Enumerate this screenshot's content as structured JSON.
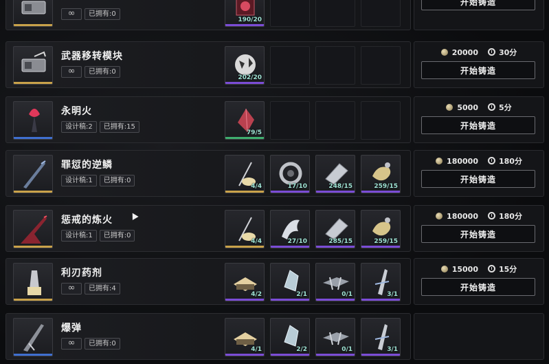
{
  "colors": {
    "gold": "#c9a24a",
    "purple": "#7b4cd6",
    "blue": "#3f6fd0",
    "green": "#3fae6e"
  },
  "rows": [
    {
      "name": "",
      "tags": [
        "∞",
        "已拥有:0"
      ],
      "rarity": "gold",
      "icon": "weapon-module-icon",
      "mats": [
        {
          "cnt": "190/20",
          "rarity": "purple",
          "icon": "crimson-core-icon"
        },
        null,
        null,
        null
      ],
      "cost": null,
      "button": "开始铸造"
    },
    {
      "name": "武器移转模块",
      "tags": [
        "∞",
        "已拥有:0"
      ],
      "rarity": "gold",
      "icon": "weapon-module-icon",
      "mats": [
        {
          "cnt": "202/20",
          "rarity": "purple",
          "icon": "orb-icon"
        },
        null,
        null,
        null
      ],
      "cost": {
        "coin": "20000",
        "time": "30分"
      },
      "button": "开始铸造"
    },
    {
      "name": "永明火",
      "tags": [
        "设计稿:2",
        "已拥有:15"
      ],
      "rarity": "blue",
      "icon": "torch-icon",
      "mats": [
        {
          "cnt": "79/5",
          "rarity": "green",
          "icon": "red-crystal-icon"
        },
        null,
        null,
        null
      ],
      "cost": {
        "coin": "5000",
        "time": "5分"
      },
      "button": "开始铸造"
    },
    {
      "name": "罪愆的逆鳞",
      "tags": [
        "设计稿:1",
        "已拥有:0"
      ],
      "rarity": "gold",
      "icon": "dark-blade-icon",
      "mats": [
        {
          "cnt": "4/4",
          "rarity": "gold",
          "icon": "staff-icon"
        },
        {
          "cnt": "17/10",
          "rarity": "purple",
          "icon": "ring-coil-icon"
        },
        {
          "cnt": "248/15",
          "rarity": "purple",
          "icon": "armor-plate-icon"
        },
        {
          "cnt": "259/15",
          "rarity": "purple",
          "icon": "horn-icon"
        }
      ],
      "cost": {
        "coin": "180000",
        "time": "180分"
      },
      "button": "开始铸造"
    },
    {
      "name": "惩戒的炼火",
      "tags": [
        "设计稿:1",
        "已拥有:0"
      ],
      "rarity": "gold",
      "icon": "red-spear-icon",
      "mats": [
        {
          "cnt": "4/4",
          "rarity": "gold",
          "icon": "staff-icon"
        },
        {
          "cnt": "27/10",
          "rarity": "purple",
          "icon": "claw-icon"
        },
        {
          "cnt": "285/15",
          "rarity": "purple",
          "icon": "armor-plate-icon"
        },
        {
          "cnt": "259/15",
          "rarity": "purple",
          "icon": "horn-icon"
        }
      ],
      "cost": {
        "coin": "180000",
        "time": "180分"
      },
      "button": "开始铸造"
    },
    {
      "name": "利刃药剂",
      "tags": [
        "∞",
        "已拥有:4"
      ],
      "rarity": "gold",
      "icon": "potion-icon",
      "mats": [
        {
          "cnt": "4/2",
          "rarity": "purple",
          "icon": "pedestal-icon"
        },
        {
          "cnt": "2/1",
          "rarity": "purple",
          "icon": "crystal-icon"
        },
        {
          "cnt": "0/1",
          "rarity": "purple",
          "icon": "drone-icon"
        },
        {
          "cnt": "3/1",
          "rarity": "purple",
          "icon": "vial-icon"
        }
      ],
      "cost": {
        "coin": "15000",
        "time": "15分"
      },
      "button": "开始铸造"
    },
    {
      "name": "爆弹",
      "tags": [
        "∞",
        "已拥有:0"
      ],
      "rarity": "blue",
      "icon": "bomb-icon",
      "mats": [
        {
          "cnt": "4/1",
          "rarity": "purple",
          "icon": "pedestal-icon"
        },
        {
          "cnt": "2/2",
          "rarity": "purple",
          "icon": "crystal-icon"
        },
        {
          "cnt": "0/1",
          "rarity": "purple",
          "icon": "drone-icon"
        },
        {
          "cnt": "3/1",
          "rarity": "purple",
          "icon": "vial-icon"
        }
      ],
      "cost": null,
      "button": null
    }
  ]
}
